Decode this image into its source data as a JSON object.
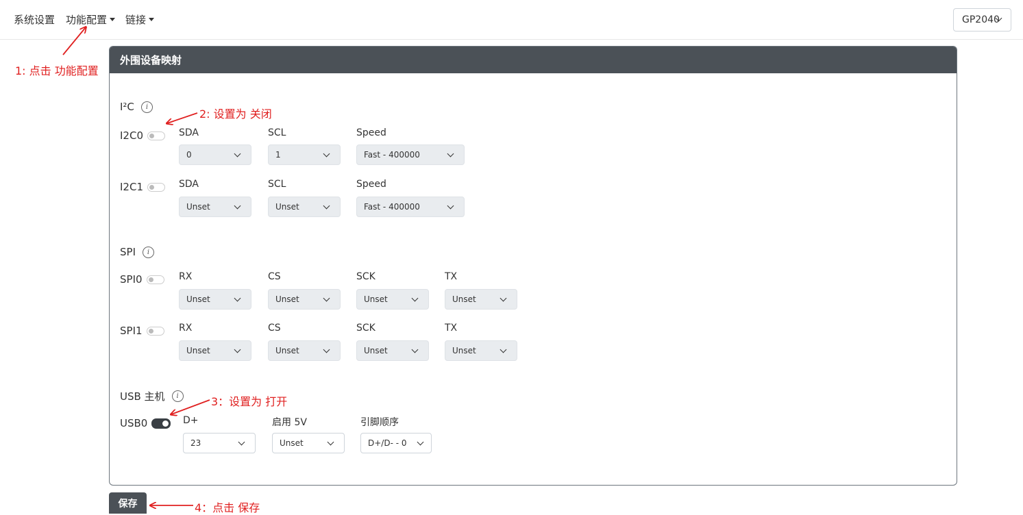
{
  "nav": {
    "items": [
      {
        "label": "系统设置",
        "dropdown": false
      },
      {
        "label": "功能配置",
        "dropdown": true
      },
      {
        "label": "链接",
        "dropdown": true
      }
    ],
    "board_select": "GP2040"
  },
  "card": {
    "title": "外围设备映射",
    "i2c": {
      "section_label": "I²C",
      "rows": [
        {
          "label": "I2C0",
          "enabled": false,
          "fields": [
            {
              "label": "SDA",
              "value": "0"
            },
            {
              "label": "SCL",
              "value": "1"
            },
            {
              "label": "Speed",
              "value": "Fast - 400000"
            }
          ]
        },
        {
          "label": "I2C1",
          "enabled": false,
          "fields": [
            {
              "label": "SDA",
              "value": "Unset"
            },
            {
              "label": "SCL",
              "value": "Unset"
            },
            {
              "label": "Speed",
              "value": "Fast - 400000"
            }
          ]
        }
      ]
    },
    "spi": {
      "section_label": "SPI",
      "rows": [
        {
          "label": "SPI0",
          "enabled": false,
          "fields": [
            {
              "label": "RX",
              "value": "Unset"
            },
            {
              "label": "CS",
              "value": "Unset"
            },
            {
              "label": "SCK",
              "value": "Unset"
            },
            {
              "label": "TX",
              "value": "Unset"
            }
          ]
        },
        {
          "label": "SPI1",
          "enabled": false,
          "fields": [
            {
              "label": "RX",
              "value": "Unset"
            },
            {
              "label": "CS",
              "value": "Unset"
            },
            {
              "label": "SCK",
              "value": "Unset"
            },
            {
              "label": "TX",
              "value": "Unset"
            }
          ]
        }
      ]
    },
    "usb": {
      "section_label": "USB 主机",
      "rows": [
        {
          "label": "USB0",
          "enabled": true,
          "fields": [
            {
              "label": "D+",
              "value": "23"
            },
            {
              "label": "启用 5V",
              "value": "Unset"
            },
            {
              "label": "引脚顺序",
              "value": "D+/D- - 0"
            }
          ]
        }
      ]
    }
  },
  "save_label": "保存",
  "annotations": {
    "a1": "1: 点击 功能配置",
    "a2": "2: 设置为 关闭",
    "a3": "3：设置为 打开",
    "a4": "4：点击 保存"
  },
  "colors": {
    "header_bg": "#4b5157",
    "annotation": "#e02020",
    "select_disabled_bg": "#e9ecef"
  }
}
